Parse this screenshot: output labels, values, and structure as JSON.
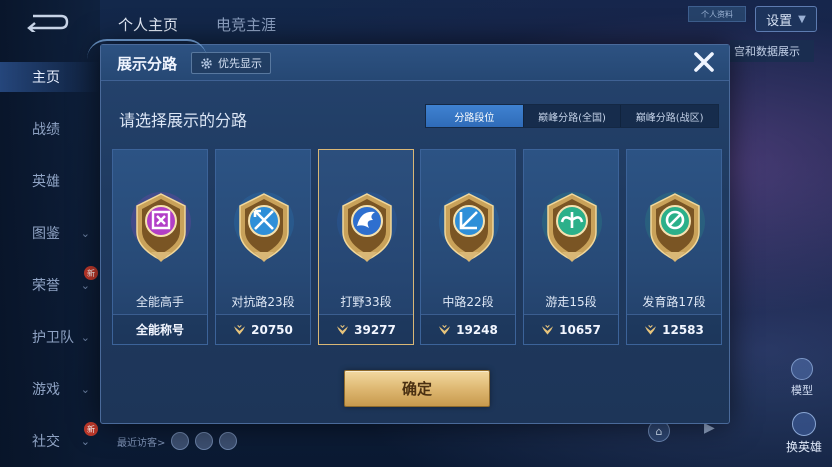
{
  "top_tabs": [
    "个人主页",
    "电竞主涯"
  ],
  "top_right": {
    "badge": "个人资料",
    "settings_label": "设置",
    "side_peek_text": "宫和数据展示"
  },
  "left_nav": [
    {
      "label": "主页",
      "active": true,
      "chevron": false,
      "new": false
    },
    {
      "label": "战绩",
      "active": false,
      "chevron": false,
      "new": false
    },
    {
      "label": "英雄",
      "active": false,
      "chevron": false,
      "new": false
    },
    {
      "label": "图鉴",
      "active": false,
      "chevron": true,
      "new": false
    },
    {
      "label": "荣誉",
      "active": false,
      "chevron": true,
      "new": true
    },
    {
      "label": "护卫队",
      "active": false,
      "chevron": true,
      "new": false
    },
    {
      "label": "游戏",
      "active": false,
      "chevron": true,
      "new": false
    },
    {
      "label": "社交",
      "active": false,
      "chevron": true,
      "new": true
    }
  ],
  "new_badge_text": "新",
  "visitors_label": "最近访客>",
  "model_label": "模型",
  "swap_hero_label": "换英雄",
  "modal": {
    "title": "展示分路",
    "priority_button": "优先显示",
    "subtitle": "请选择展示的分路",
    "segment_tabs": [
      {
        "label": "分路段位",
        "active": true
      },
      {
        "label": "巅峰分路(全国)",
        "active": false
      },
      {
        "label": "巅峰分路(战区)",
        "active": false
      }
    ],
    "cards": [
      {
        "label": "全能高手",
        "score": "全能称号",
        "show_icon": false,
        "selected": false,
        "emblem": "all-rounder-emblem",
        "color": "#b23fc7"
      },
      {
        "label": "对抗路23段",
        "score": "20750",
        "show_icon": true,
        "selected": false,
        "emblem": "clash-lane-emblem",
        "color": "#2f8fd8"
      },
      {
        "label": "打野33段",
        "score": "39277",
        "show_icon": true,
        "selected": true,
        "emblem": "jungle-emblem",
        "color": "#2e6fcf"
      },
      {
        "label": "中路22段",
        "score": "19248",
        "show_icon": true,
        "selected": false,
        "emblem": "mid-lane-emblem",
        "color": "#2f8fd8"
      },
      {
        "label": "游走15段",
        "score": "10657",
        "show_icon": true,
        "selected": false,
        "emblem": "roam-emblem",
        "color": "#2bb08a"
      },
      {
        "label": "发育路17段",
        "score": "12583",
        "show_icon": true,
        "selected": false,
        "emblem": "farm-lane-emblem",
        "color": "#2bb08a"
      }
    ],
    "confirm_button": "确定"
  },
  "colors": {
    "gold": "#d9b776",
    "tab_active": "#3f82d1",
    "panel": "#25446f"
  }
}
